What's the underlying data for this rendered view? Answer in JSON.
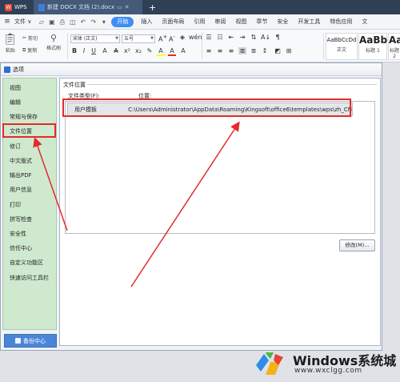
{
  "tabbar": {
    "app_tab": "WPS",
    "doc_tab": "新建 DOCX 文档 (2).docx",
    "add_icon": "+"
  },
  "menubar": {
    "file_menu": "文件",
    "items": [
      "开始",
      "插入",
      "页面布局",
      "引用",
      "审阅",
      "视图",
      "章节",
      "安全",
      "开发工具",
      "特色应用",
      "文"
    ],
    "active_index": 0
  },
  "ribbon": {
    "paste": "粘贴",
    "cut": "剪切",
    "copy": "复制",
    "format_painter": "格式刷",
    "font_name": "宋体 (正文)",
    "font_size": "五号",
    "styles": [
      {
        "sample": "AaBbCcDd",
        "caption": "正文"
      },
      {
        "sample": "AaBb",
        "caption": "标题 1"
      },
      {
        "sample": "AaBb",
        "caption": "标题 2"
      }
    ]
  },
  "dialog": {
    "title": "选项",
    "sidebar_items": [
      "视图",
      "编辑",
      "常规与保存",
      "文件位置",
      "修订",
      "中文版式",
      "输出PDF",
      "用户信息",
      "打印",
      "拼写检查",
      "安全性",
      "信任中心",
      "自定义功能区",
      "快速访问工具栏"
    ],
    "selected_item": "文件位置",
    "backup_button": "备份中心",
    "group_label": "文件位置",
    "col_type": "文件类型(F):",
    "col_location": "位置:",
    "rows": [
      {
        "type": "用户模板",
        "location": "C:\\Users\\Administrator\\AppData\\Roaming\\Kingsoft\\office6\\templates\\wps\\zh_CN"
      }
    ],
    "modify_button": "修改(M)..."
  },
  "watermark": {
    "title": "Windows系统城",
    "url": "www.wxclgg.com"
  },
  "colors": {
    "accent": "#3f8ef3",
    "annotation_red": "#e42a2a",
    "sidebar_green": "#cfe9cf",
    "tabbar": "#2f3f55"
  }
}
